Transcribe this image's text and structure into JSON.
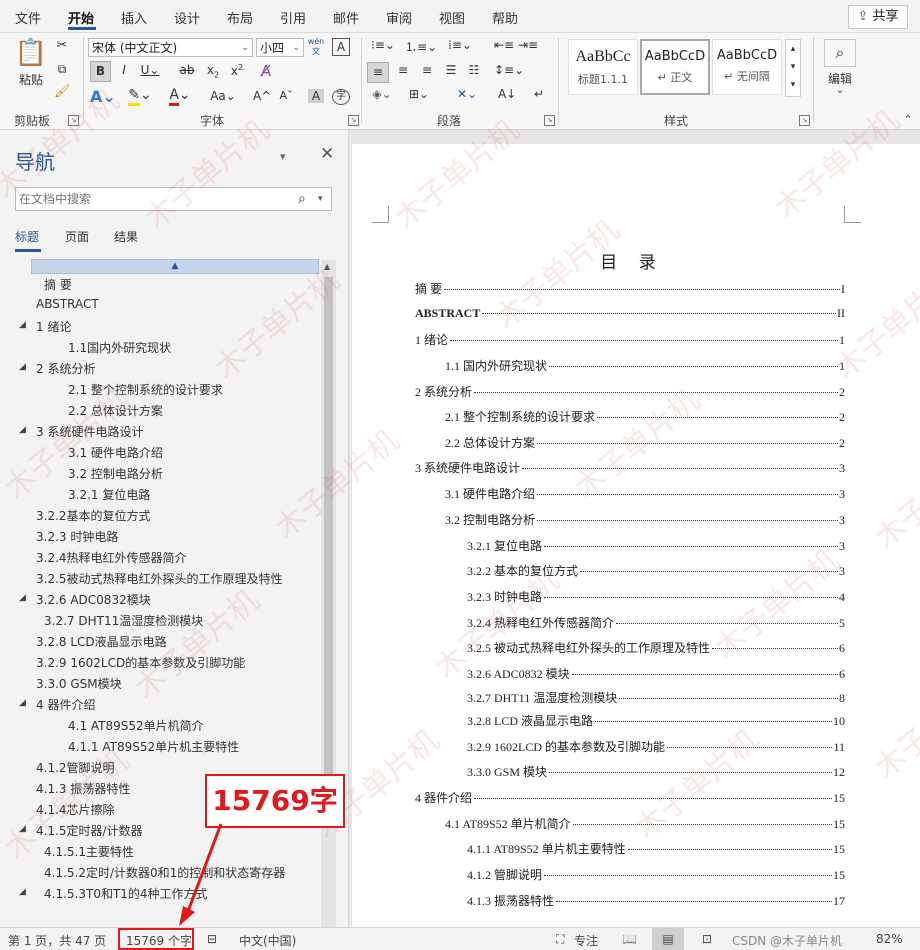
{
  "menu": {
    "items": [
      "文件",
      "开始",
      "插入",
      "设计",
      "布局",
      "引用",
      "邮件",
      "审阅",
      "视图",
      "帮助"
    ],
    "active": "开始",
    "share": "共享"
  },
  "ribbon": {
    "clipboard": {
      "paste": "粘贴",
      "label": "剪贴板"
    },
    "font": {
      "family": "宋体 (中文正文)",
      "size": "小四",
      "label": "字体"
    },
    "paragraph": {
      "label": "段落"
    },
    "styles": {
      "label": "样式",
      "items": [
        {
          "sample": "AaBbCc",
          "name": "标题1.1.1"
        },
        {
          "sample": "AaBbCcD",
          "name": "正文"
        },
        {
          "sample": "AaBbCcD",
          "name": "无间隔"
        }
      ]
    },
    "editing": {
      "label": "编辑"
    }
  },
  "nav": {
    "title": "导航",
    "search_placeholder": "在文档中搜索",
    "tabs": [
      "标题",
      "页面",
      "结果"
    ],
    "items": [
      {
        "text": "摘  要",
        "indent": 1,
        "tri": false
      },
      {
        "text": "ABSTRACT",
        "indent": 0,
        "tri": false
      },
      {
        "text": "1 绪论",
        "indent": 0,
        "tri": true
      },
      {
        "text": "1.1国内外研究现状",
        "indent": 2,
        "tri": false
      },
      {
        "text": "2 系统分析",
        "indent": 0,
        "tri": true
      },
      {
        "text": "2.1 整个控制系统的设计要求",
        "indent": 2,
        "tri": false
      },
      {
        "text": "2.2 总体设计方案",
        "indent": 2,
        "tri": false
      },
      {
        "text": "3 系统硬件电路设计",
        "indent": 0,
        "tri": true
      },
      {
        "text": "3.1 硬件电路介绍",
        "indent": 2,
        "tri": false
      },
      {
        "text": "3.2 控制电路分析",
        "indent": 2,
        "tri": false
      },
      {
        "text": "3.2.1 复位电路",
        "indent": 2,
        "tri": false
      },
      {
        "text": "3.2.2基本的复位方式",
        "indent": 0,
        "tri": false
      },
      {
        "text": "3.2.3 时钟电路",
        "indent": 0,
        "tri": false
      },
      {
        "text": "3.2.4热释电红外传感器简介",
        "indent": 0,
        "tri": false
      },
      {
        "text": "3.2.5被动式热释电红外探头的工作原理及特性",
        "indent": 0,
        "tri": false
      },
      {
        "text": "3.2.6 ADC0832模块",
        "indent": 0,
        "tri": true
      },
      {
        "text": "3.2.7 DHT11温湿度检测模块",
        "indent": 1,
        "tri": false
      },
      {
        "text": "3.2.8 LCD液晶显示电路",
        "indent": 0,
        "tri": false
      },
      {
        "text": "3.2.9 1602LCD的基本参数及引脚功能",
        "indent": 0,
        "tri": false
      },
      {
        "text": "3.3.0 GSM模块",
        "indent": 0,
        "tri": false
      },
      {
        "text": "4 器件介绍",
        "indent": 0,
        "tri": true
      },
      {
        "text": "4.1  AT89S52单片机简介",
        "indent": 2,
        "tri": false
      },
      {
        "text": "4.1.1 AT89S52单片机主要特性",
        "indent": 2,
        "tri": false
      },
      {
        "text": "4.1.2管脚说明",
        "indent": 0,
        "tri": false
      },
      {
        "text": "4.1.3 振荡器特性",
        "indent": 0,
        "tri": false
      },
      {
        "text": "4.1.4芯片擦除",
        "indent": 0,
        "tri": false
      },
      {
        "text": "4.1.5定时器/计数器",
        "indent": 0,
        "tri": true
      },
      {
        "text": "4.1.5.1主要特性",
        "indent": 1,
        "tri": false
      },
      {
        "text": "4.1.5.2定时/计数器0和1的控制和状态寄存器",
        "indent": 1,
        "tri": false
      },
      {
        "text": "4.1.5.3T0和T1的4种工作方式",
        "indent": 1,
        "tri": true
      }
    ]
  },
  "document": {
    "toc_title": "目 录",
    "toc": [
      {
        "text": "摘    要",
        "page": "I",
        "level": 0,
        "bold": false
      },
      {
        "text": "ABSTRACT",
        "page": "II",
        "level": 0,
        "bold": true
      },
      {
        "text": "1  绪论",
        "page": "1",
        "level": 0,
        "bold": false
      },
      {
        "text": "1.1 国内外研究现状",
        "page": "1",
        "level": 1,
        "bold": false
      },
      {
        "text": "2  系统分析",
        "page": "2",
        "level": 0,
        "bold": false
      },
      {
        "text": "2.1  整个控制系统的设计要求",
        "page": "2",
        "level": 1,
        "bold": false
      },
      {
        "text": "2.2  总体设计方案",
        "page": "2",
        "level": 1,
        "bold": false
      },
      {
        "text": "3  系统硬件电路设计",
        "page": "3",
        "level": 0,
        "bold": false
      },
      {
        "text": "3.1  硬件电路介绍",
        "page": "3",
        "level": 1,
        "bold": false
      },
      {
        "text": "3.2  控制电路分析",
        "page": "3",
        "level": 1,
        "bold": false
      },
      {
        "text": "3.2.1  复位电路",
        "page": "3",
        "level": 2,
        "bold": false
      },
      {
        "text": "3.2.2 基本的复位方式",
        "page": "3",
        "level": 2,
        "bold": false
      },
      {
        "text": "3.2.3  时钟电路",
        "page": "4",
        "level": 2,
        "bold": false
      },
      {
        "text": "3.2.4 热释电红外传感器简介",
        "page": "5",
        "level": 2,
        "bold": false
      },
      {
        "text": "3.2.5 被动式热释电红外探头的工作原理及特性",
        "page": "6",
        "level": 2,
        "bold": false
      },
      {
        "text": "3.2.6 ADC0832 模块",
        "page": "6",
        "level": 2,
        "bold": false
      },
      {
        "text": "3.2.7 DHT11 温湿度检测模块",
        "page": "8",
        "level": 2,
        "bold": false
      },
      {
        "text": "3.2.8 LCD 液晶显示电路",
        "page": "10",
        "level": 2,
        "bold": false
      },
      {
        "text": "3.2.9 1602LCD 的基本参数及引脚功能",
        "page": "11",
        "level": 2,
        "bold": false
      },
      {
        "text": "3.3.0 GSM  模块",
        "page": "12",
        "level": 2,
        "bold": false
      },
      {
        "text": "4  器件介绍",
        "page": "15",
        "level": 0,
        "bold": false
      },
      {
        "text": "4.1         AT89S52 单片机简介",
        "page": "15",
        "level": 1,
        "bold": false
      },
      {
        "text": "4.1.1 AT89S52 单片机主要特性",
        "page": "15",
        "level": 2,
        "bold": false
      },
      {
        "text": "4.1.2 管脚说明",
        "page": "15",
        "level": 2,
        "bold": false
      },
      {
        "text": "4.1.3  振荡器特性",
        "page": "17",
        "level": 2,
        "bold": false
      }
    ]
  },
  "annotation": {
    "text": "15769字"
  },
  "status": {
    "page": "第 1 页，共 47 页",
    "words": "15769 个字",
    "lang": "中文(中国)",
    "focus": "专注",
    "zoom": "82%",
    "csdn": "CSDN @木子单片机"
  },
  "watermark": "木子单片机",
  "colors": {
    "accent": "#2b579a",
    "annotation": "#e0191c"
  }
}
